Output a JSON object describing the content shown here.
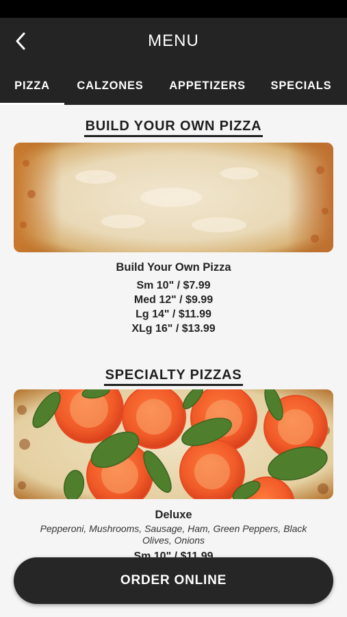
{
  "header": {
    "title": "MENU",
    "back_icon": "chevron-left-icon"
  },
  "tabs": [
    {
      "label": "PIZZA",
      "active": true
    },
    {
      "label": "CALZONES",
      "active": false
    },
    {
      "label": "APPETIZERS",
      "active": false
    },
    {
      "label": "SPECIALS",
      "active": false
    }
  ],
  "sections": [
    {
      "title": "BUILD YOUR OWN PIZZA",
      "item": {
        "name": "Build Your Own Pizza",
        "prices": [
          "Sm 10\" / $7.99",
          "Med 12\" / $9.99",
          "Lg 14\" / $11.99",
          "XLg 16\" / $13.99"
        ]
      }
    },
    {
      "title": "SPECIALTY PIZZAS",
      "item": {
        "name": "Deluxe",
        "description": "Pepperoni, Mushrooms, Sausage, Ham, Green Peppers, Black Olives, Onions",
        "prices": [
          "Sm 10\" / $11.99"
        ]
      }
    }
  ],
  "order_button": {
    "label": "ORDER ONLINE"
  },
  "colors": {
    "header_bg": "#242424",
    "status_bar": "#000000",
    "page_bg": "#f5f5f5",
    "button_bg": "#262626"
  }
}
